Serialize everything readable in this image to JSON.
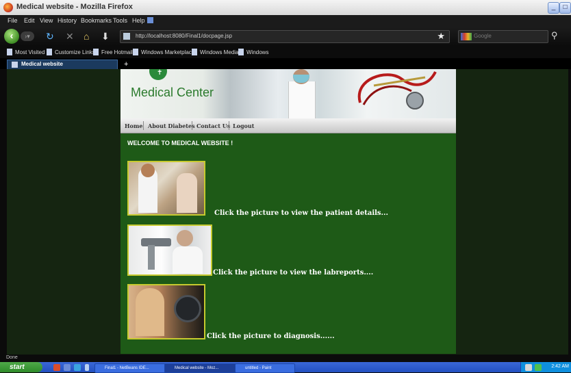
{
  "window": {
    "title": "Medical website - Mozilla Firefox",
    "controls": {
      "minimize": "_",
      "maximize": "□"
    }
  },
  "menu": [
    "File",
    "Edit",
    "View",
    "History",
    "Bookmarks",
    "Tools",
    "Help"
  ],
  "nav": {
    "url": "http://localhost:8080/Final1/docpage.jsp",
    "search_placeholder": "Google"
  },
  "bookmarks": [
    "Most Visited",
    "Customize Links",
    "Free Hotmail",
    "Windows Marketplace",
    "Windows Media",
    "Windows"
  ],
  "tabs": [
    {
      "label": "Medical website"
    }
  ],
  "site": {
    "brand": "Medical Center",
    "nav": [
      "Home",
      "About Diabetes",
      "Contact Us",
      "Logout"
    ],
    "welcome": "WELCOME TO MEDICAL WEBSITE !",
    "items": [
      {
        "caption": "Click the picture to view the patient details..."
      },
      {
        "caption": "Click the picture to view the labreports...."
      },
      {
        "caption": "Click the picture to diagnosis......"
      }
    ]
  },
  "status": "Done",
  "taskbar": {
    "start": "start",
    "windows": [
      "Final1 - NetBeans IDE...",
      "Medical website - Moz...",
      "untitled - Paint"
    ],
    "clock": "2:42 AM"
  },
  "colors": {
    "site_bg": "#1e5a17",
    "picture_border": "#c7ca2f",
    "brand_text": "#2a7a2c"
  }
}
